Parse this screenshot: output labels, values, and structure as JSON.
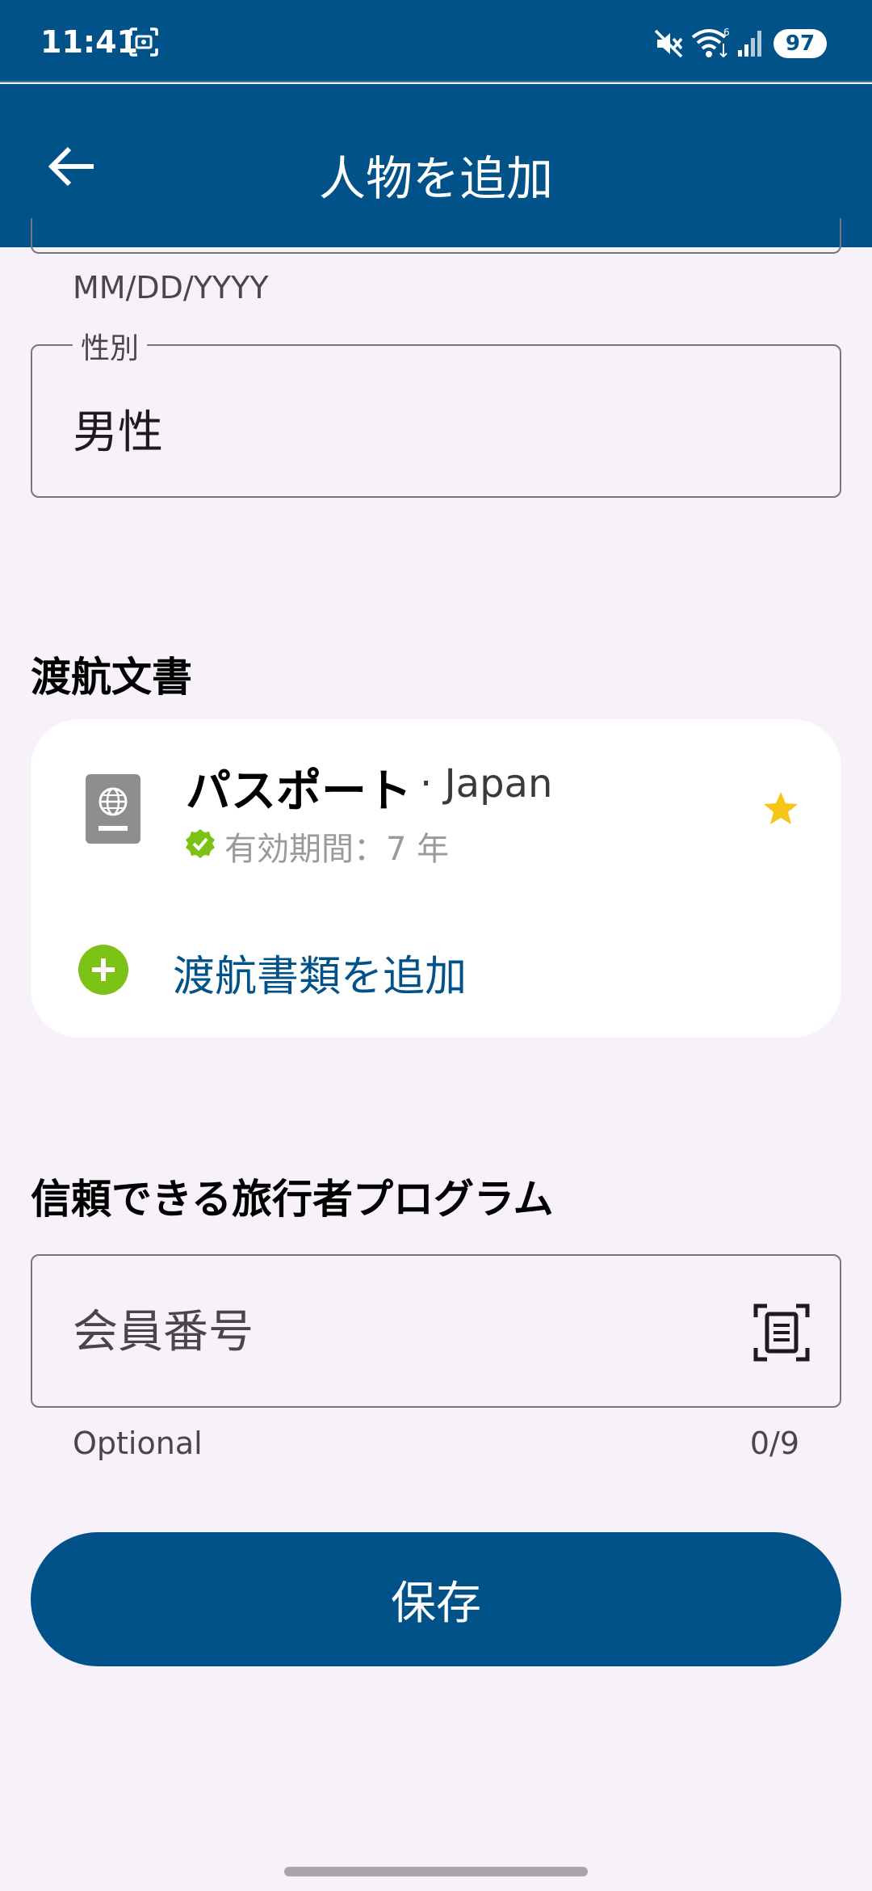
{
  "status_bar": {
    "time": "11:41",
    "battery": "97",
    "icons": [
      "screenshot-icon",
      "mute-icon",
      "wifi-icon",
      "signal-icon"
    ]
  },
  "app_bar": {
    "title": "人物を追加",
    "back_icon": "arrow-left-icon"
  },
  "form": {
    "date_helper": "MM/DD/YYYY",
    "gender": {
      "label": "性別",
      "value": "男性"
    }
  },
  "travel_documents": {
    "section_title": "渡航文書",
    "items": [
      {
        "name": "パスポート",
        "country": "· Japan",
        "validity": "有効期間：7 年",
        "favorite": true
      }
    ],
    "add_label": "渡航書類を追加"
  },
  "trusted_traveler": {
    "section_title": "信頼できる旅行者プログラム",
    "member_number": {
      "placeholder": "会員番号",
      "value": "",
      "helper": "Optional",
      "counter": "0/9"
    }
  },
  "actions": {
    "save_label": "保存"
  },
  "colors": {
    "primary": "#02528a",
    "background": "#f7f2f9",
    "accent_green": "#7cc215",
    "star": "#f5c518"
  }
}
